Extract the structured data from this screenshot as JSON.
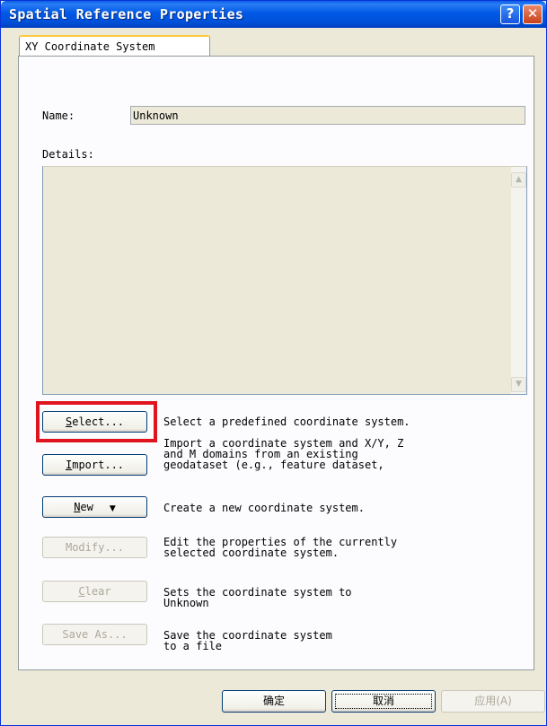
{
  "window": {
    "title": "Spatial Reference Properties",
    "help_glyph": "?",
    "close_glyph": "✕"
  },
  "tab": {
    "label": "XY Coordinate System"
  },
  "name": {
    "label": "Name:",
    "value": "Unknown"
  },
  "details": {
    "label": "Details:",
    "value": ""
  },
  "actions": [
    {
      "button": "Select...",
      "mnemonic": "S",
      "rest": "elect...",
      "enabled": true,
      "description": "Select a predefined coordinate system."
    },
    {
      "button": "Import...",
      "mnemonic": "I",
      "rest": "mport...",
      "enabled": true,
      "description": "Import a coordinate system and X/Y, Z\nand M domains from an existing\ngeodataset (e.g., feature dataset,"
    },
    {
      "button": "New",
      "mnemonic": "N",
      "rest": "ew",
      "enabled": true,
      "dropdown": "▼",
      "description": "Create a new coordinate system."
    },
    {
      "button": "Modify...",
      "mnemonic": "o",
      "enabled": false,
      "description": "Edit the properties of the currently\nselected coordinate system."
    },
    {
      "button": "Clear",
      "mnemonic": "C",
      "rest": "lear",
      "enabled": false,
      "description": "Sets the coordinate system to\nUnknown"
    },
    {
      "button": "Save As...",
      "mnemonic": "v",
      "enabled": false,
      "description": "Save the coordinate system\nto a file"
    }
  ],
  "dialog_buttons": {
    "ok": "确定",
    "cancel": "取消",
    "apply": "应用(A)"
  },
  "colors": {
    "titlebar": "#0058e0",
    "highlight": "#e0141e",
    "face": "#ece9d8"
  }
}
